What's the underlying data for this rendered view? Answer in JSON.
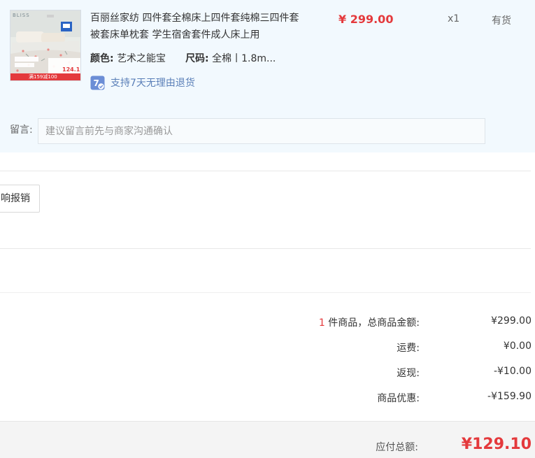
{
  "item": {
    "thumbnail": {
      "brand": "BLISS",
      "promo_price": "124.1",
      "promo_text": "满159减100"
    },
    "title": "百丽丝家纺 四件套全棉床上四件套纯棉三四件套 被套床单枕套 学生宿舍套件成人床上用",
    "color_key": "颜色:",
    "color_value": "艺术之能宝",
    "size_key": "尺码:",
    "size_value": "全棉丨1.8m...",
    "price": "¥ 299.00",
    "quantity": "x1",
    "stock": "有货",
    "return_badge": "7",
    "return_policy": "支持7天无理由退货"
  },
  "remark": {
    "label": "留言:",
    "placeholder": "建议留言前先与商家沟通确认"
  },
  "invoice": {
    "button_label": "响报销"
  },
  "summary": {
    "item_count": "1",
    "item_count_suffix": " 件商品，总商品金额:",
    "goods_total": "¥299.00",
    "shipping_label": "运费:",
    "shipping_value": "¥0.00",
    "cashback_label": "返现:",
    "cashback_value": "-¥10.00",
    "discount_label": "商品优惠:",
    "discount_value": "-¥159.90",
    "payable_label": "应付总额:",
    "payable_value": "¥129.10"
  },
  "colors": {
    "accent_red": "#e4393c",
    "card_bg": "#f2f9fe",
    "link_blue": "#5a7fb8"
  },
  "icons": {
    "return_icon": "seven-day-return-icon",
    "thumbnail": "bedding-product-image"
  }
}
